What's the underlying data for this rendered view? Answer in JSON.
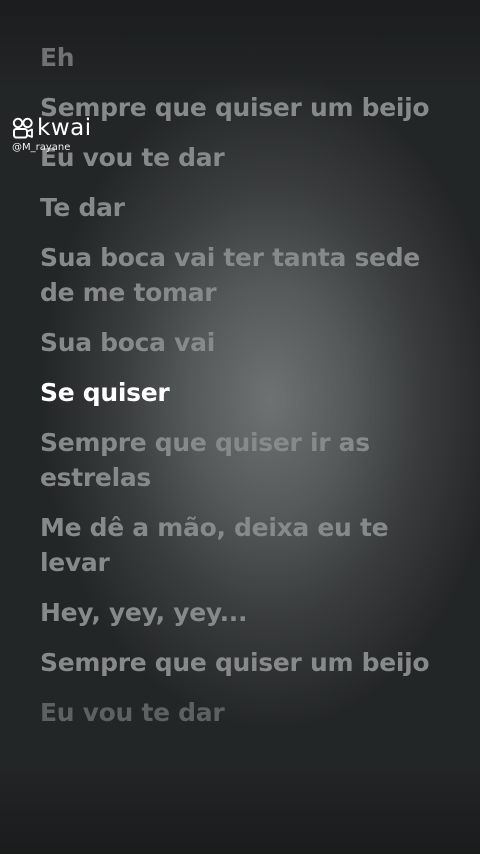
{
  "watermark": {
    "brand": "kwai",
    "username": "@M_rayane",
    "logo_icon": "kwai-logo-icon",
    "text_color": "#ffffff"
  },
  "lyrics": {
    "lines": [
      "Eh",
      "Sempre que quiser um beijo",
      "Eu vou te dar",
      "Te dar",
      "Sua boca vai ter tanta sede de me tomar",
      "Sua boca vai",
      "Se quiser",
      "Sempre que quiser ir as estrelas",
      "Me dê a mão, deixa eu te levar",
      "Hey, yey, yey...",
      "Sempre que quiser um beijo",
      "Eu vou te dar"
    ],
    "current_index": 6,
    "active_color": "#ffffff",
    "inactive_color": "#878a8a"
  }
}
